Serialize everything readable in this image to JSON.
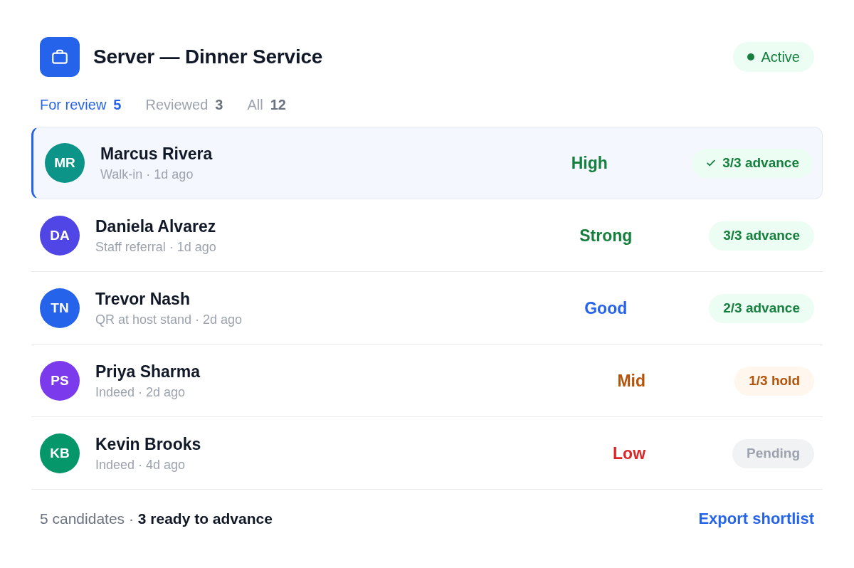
{
  "header": {
    "title": "Server — Dinner Service",
    "status": {
      "label": "Active",
      "kind": "active"
    }
  },
  "tabs": [
    {
      "label": "For review",
      "count": "5",
      "selected": true
    },
    {
      "label": "Reviewed",
      "count": "3",
      "selected": false
    },
    {
      "label": "All",
      "count": "12",
      "selected": false
    }
  ],
  "candidates": [
    {
      "initials": "MR",
      "color": "#0d9488",
      "name": "Marcus Rivera",
      "meta": "Walk-in · 1d ago",
      "selected": true,
      "rating": {
        "label": "High",
        "color": "#15803d"
      },
      "verdict": {
        "label": "3/3 advance",
        "kind": "advance",
        "checked": true
      }
    },
    {
      "initials": "DA",
      "color": "#4f46e5",
      "name": "Daniela Alvarez",
      "meta": "Staff referral · 1d ago",
      "selected": false,
      "rating": {
        "label": "Strong",
        "color": "#15803d"
      },
      "verdict": {
        "label": "3/3 advance",
        "kind": "advance",
        "checked": false
      }
    },
    {
      "initials": "TN",
      "color": "#2563eb",
      "name": "Trevor Nash",
      "meta": "QR at host stand · 2d ago",
      "selected": false,
      "rating": {
        "label": "Good",
        "color": "#2563eb"
      },
      "verdict": {
        "label": "2/3 advance",
        "kind": "advance",
        "checked": false
      }
    },
    {
      "initials": "PS",
      "color": "#7c3aed",
      "name": "Priya Sharma",
      "meta": "Indeed · 2d ago",
      "selected": false,
      "rating": {
        "label": "Mid",
        "color": "#b45309"
      },
      "verdict": {
        "label": "1/3 hold",
        "kind": "hold",
        "checked": false
      }
    },
    {
      "initials": "KB",
      "color": "#059669",
      "name": "Kevin Brooks",
      "meta": "Indeed · 4d ago",
      "selected": false,
      "rating": {
        "label": "Low",
        "color": "#dc2626"
      },
      "verdict": {
        "label": "Pending",
        "kind": "pending",
        "checked": false
      }
    }
  ],
  "footer": {
    "summary": "5 candidates · **3 ready to advance**",
    "action": "Export shortlist"
  }
}
